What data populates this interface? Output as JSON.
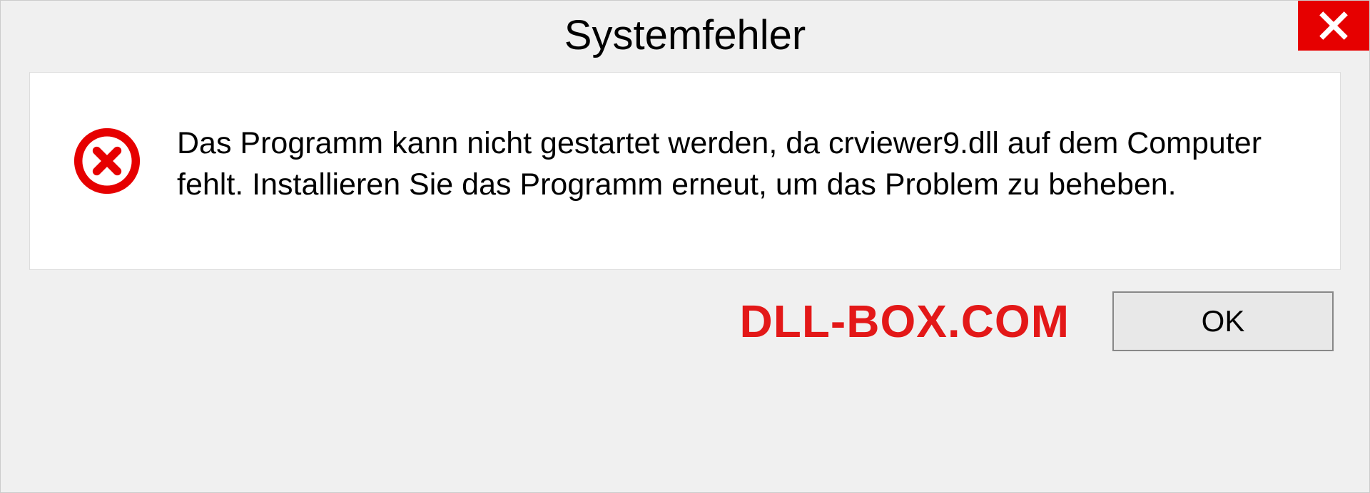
{
  "dialog": {
    "title": "Systemfehler",
    "message": "Das Programm kann nicht gestartet werden, da crviewer9.dll auf dem Computer fehlt. Installieren Sie das Programm erneut, um das Problem zu beheben.",
    "ok_label": "OK"
  },
  "watermark": "DLL-BOX.COM"
}
